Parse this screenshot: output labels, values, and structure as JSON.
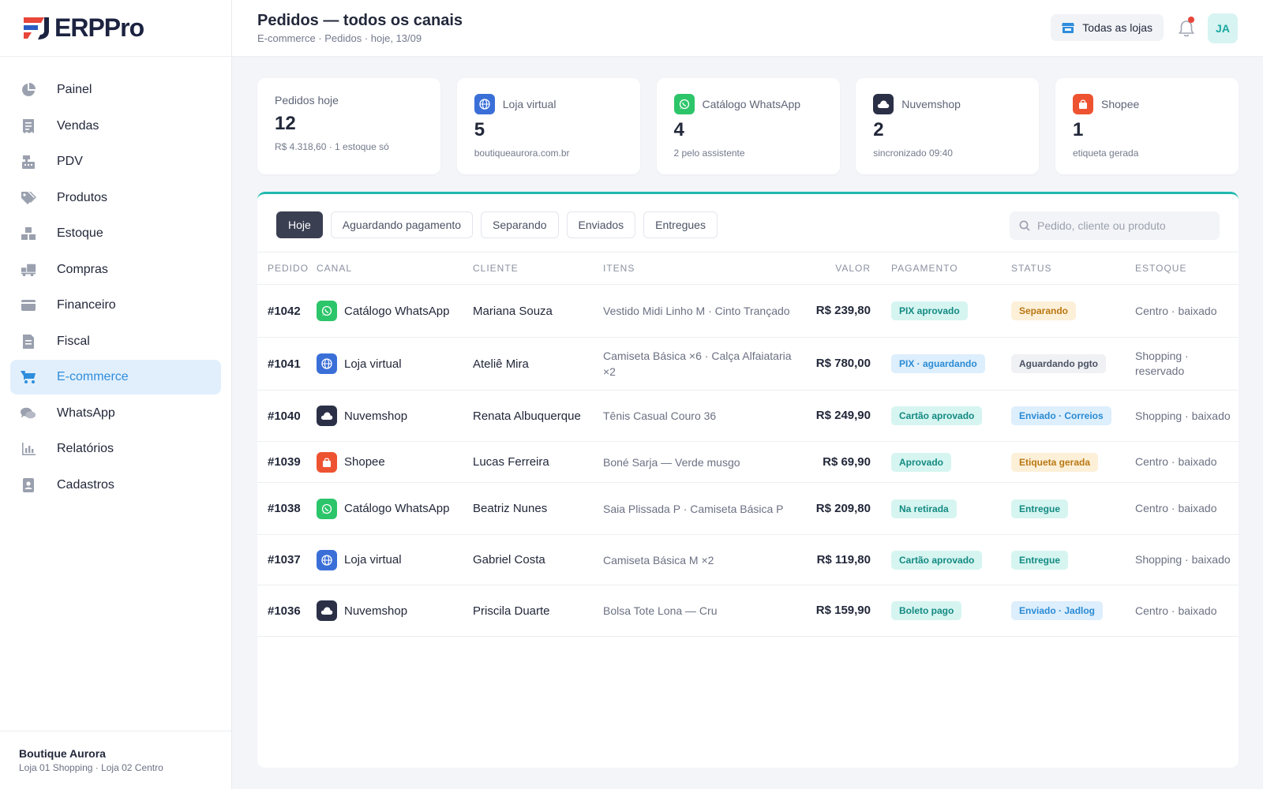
{
  "app": {
    "name": "ERPPro"
  },
  "sidebar": {
    "items": [
      {
        "label": "Painel",
        "icon": "pie-chart-icon"
      },
      {
        "label": "Vendas",
        "icon": "receipt-icon"
      },
      {
        "label": "PDV",
        "icon": "cash-register-icon"
      },
      {
        "label": "Produtos",
        "icon": "tag-icon"
      },
      {
        "label": "Estoque",
        "icon": "boxes-icon"
      },
      {
        "label": "Compras",
        "icon": "truck-icon"
      },
      {
        "label": "Financeiro",
        "icon": "wallet-icon"
      },
      {
        "label": "Fiscal",
        "icon": "document-icon"
      },
      {
        "label": "E-commerce",
        "icon": "cart-icon",
        "active": true
      },
      {
        "label": "WhatsApp",
        "icon": "chat-icon"
      },
      {
        "label": "Relatórios",
        "icon": "bar-chart-icon"
      },
      {
        "label": "Cadastros",
        "icon": "contact-icon"
      }
    ],
    "footer": {
      "company": "Boutique Aurora",
      "stores": "Loja 01 Shopping · Loja 02 Centro"
    }
  },
  "header": {
    "title": "Pedidos — todos os canais",
    "breadcrumb": "E-commerce · Pedidos · hoje, 13/09",
    "store_selector": "Todas as lojas",
    "avatar": "JA"
  },
  "stats": [
    {
      "title": "Pedidos hoje",
      "value": "12",
      "sub": "R$ 4.318,60 · 1 estoque só"
    },
    {
      "title": "Loja virtual",
      "value": "5",
      "sub": "boutiqueaurora.com.br"
    },
    {
      "title": "Catálogo WhatsApp",
      "value": "4",
      "sub": "2 pelo assistente"
    },
    {
      "title": "Nuvemshop",
      "value": "2",
      "sub": "sincronizado 09:40"
    },
    {
      "title": "Shopee",
      "value": "1",
      "sub": "etiqueta gerada"
    }
  ],
  "filters": {
    "tabs": [
      "Hoje",
      "Aguardando pagamento",
      "Separando",
      "Enviados",
      "Entregues"
    ],
    "active": "Hoje",
    "search_placeholder": "Pedido, cliente ou produto"
  },
  "table": {
    "columns": [
      "PEDIDO",
      "CANAL",
      "CLIENTE",
      "ITENS",
      "VALOR",
      "PAGAMENTO",
      "STATUS",
      "ESTOQUE"
    ],
    "rows": [
      {
        "order": "#1042",
        "channel": "Catálogo WhatsApp",
        "channel_type": "whatsapp",
        "customer": "Mariana Souza",
        "items": "Vestido Midi Linho M · Cinto Trançado",
        "value": "R$ 239,80",
        "payment": "PIX aprovado",
        "payment_color": "teal",
        "status": "Separando",
        "status_color": "amber",
        "stock": "Centro · baixado"
      },
      {
        "order": "#1041",
        "channel": "Loja virtual",
        "channel_type": "web",
        "customer": "Ateliê Mira",
        "items": "Camiseta Básica ×6 · Calça Alfaiataria ×2",
        "value": "R$ 780,00",
        "payment": "PIX · aguardando",
        "payment_color": "blue",
        "status": "Aguardando pgto",
        "status_color": "gray",
        "stock": "Shopping · reservado"
      },
      {
        "order": "#1040",
        "channel": "Nuvemshop",
        "channel_type": "nuvemshop",
        "customer": "Renata Albuquerque",
        "items": "Tênis Casual Couro 36",
        "value": "R$ 249,90",
        "payment": "Cartão aprovado",
        "payment_color": "teal",
        "status": "Enviado · Correios",
        "status_color": "blue",
        "stock": "Shopping · baixado"
      },
      {
        "order": "#1039",
        "channel": "Shopee",
        "channel_type": "shopee",
        "customer": "Lucas Ferreira",
        "items": "Boné Sarja — Verde musgo",
        "value": "R$ 69,90",
        "payment": "Aprovado",
        "payment_color": "teal",
        "status": "Etiqueta gerada",
        "status_color": "amber",
        "stock": "Centro · baixado"
      },
      {
        "order": "#1038",
        "channel": "Catálogo WhatsApp",
        "channel_type": "whatsapp",
        "customer": "Beatriz Nunes",
        "items": "Saia Plissada P · Camiseta Básica P",
        "value": "R$ 209,80",
        "payment": "Na retirada",
        "payment_color": "teal",
        "status": "Entregue",
        "status_color": "teal",
        "stock": "Centro · baixado"
      },
      {
        "order": "#1037",
        "channel": "Loja virtual",
        "channel_type": "web",
        "customer": "Gabriel Costa",
        "items": "Camiseta Básica M ×2",
        "value": "R$ 119,80",
        "payment": "Cartão aprovado",
        "payment_color": "teal",
        "status": "Entregue",
        "status_color": "teal",
        "stock": "Shopping · baixado"
      },
      {
        "order": "#1036",
        "channel": "Nuvemshop",
        "channel_type": "nuvemshop",
        "customer": "Priscila Duarte",
        "items": "Bolsa Tote Lona — Cru",
        "value": "R$ 159,90",
        "payment": "Boleto pago",
        "payment_color": "teal",
        "status": "Enviado · Jadlog",
        "status_color": "blue",
        "stock": "Centro · baixado"
      }
    ]
  },
  "colors": {
    "accent": "#22b8b0",
    "nav_active": "#2e8ddc",
    "brand_red": "#e8463a",
    "brand_navy": "#1c2340"
  }
}
